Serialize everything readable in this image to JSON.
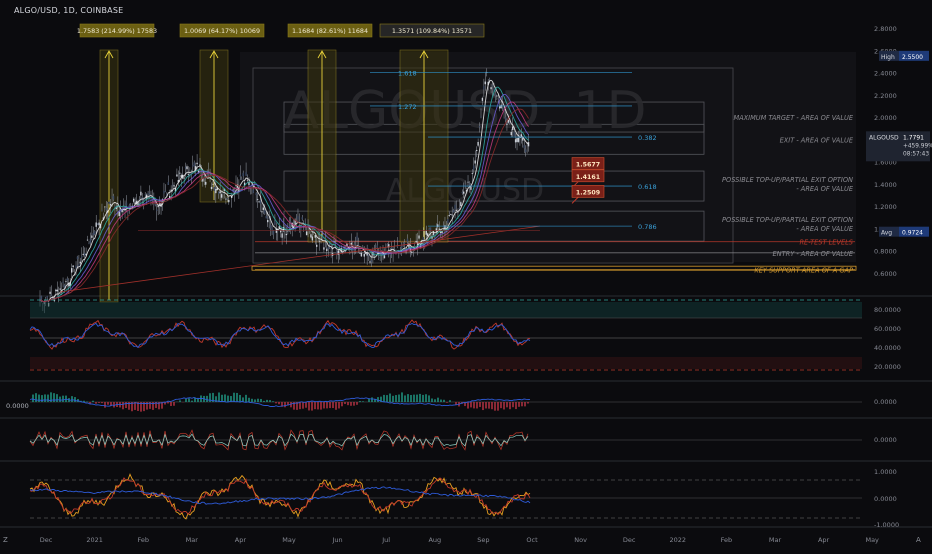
{
  "header": {
    "symbol_line": "ALGO/USD, 1D, COINBASE"
  },
  "watermark": {
    "symbol": "ALGOUSD, 1D",
    "pair": "ALGO/USD"
  },
  "chart_data": {
    "type": "candlestick",
    "title": "ALGO/USD, 1D, COINBASE",
    "ylim": [
      0.5,
      2.8
    ],
    "yticks": [
      "2.8000",
      "2.6000",
      "2.4000",
      "2.2000",
      "2.0000",
      "1.8000",
      "1.6000",
      "1.4000",
      "1.2000",
      "1.0000",
      "0.8000",
      "0.6000"
    ],
    "x_labels": [
      "Dec",
      "2021",
      "Feb",
      "Mar",
      "Apr",
      "May",
      "Jun",
      "Jul",
      "Aug",
      "Sep",
      "Oct",
      "Nov",
      "Dec",
      "2022",
      "Feb",
      "Mar",
      "Apr",
      "May"
    ],
    "price_series": [
      {
        "x": 0,
        "close": 0.35
      },
      {
        "x": 1,
        "close": 0.4
      },
      {
        "x": 2,
        "close": 0.55
      },
      {
        "x": 3,
        "close": 0.75
      },
      {
        "x": 4,
        "close": 1.05
      },
      {
        "x": 5,
        "close": 1.25
      },
      {
        "x": 6,
        "close": 1.15
      },
      {
        "x": 7,
        "close": 1.3
      },
      {
        "x": 8,
        "close": 1.2
      },
      {
        "x": 9,
        "close": 1.35
      },
      {
        "x": 10,
        "close": 1.5
      },
      {
        "x": 11,
        "close": 1.55
      },
      {
        "x": 12,
        "close": 1.4
      },
      {
        "x": 13,
        "close": 1.3
      },
      {
        "x": 14,
        "close": 1.45
      },
      {
        "x": 15,
        "close": 1.35
      },
      {
        "x": 16,
        "close": 1.0
      },
      {
        "x": 17,
        "close": 0.95
      },
      {
        "x": 18,
        "close": 1.05
      },
      {
        "x": 19,
        "close": 0.92
      },
      {
        "x": 20,
        "close": 0.85
      },
      {
        "x": 21,
        "close": 0.8
      },
      {
        "x": 22,
        "close": 0.85
      },
      {
        "x": 23,
        "close": 0.75
      },
      {
        "x": 24,
        "close": 0.82
      },
      {
        "x": 25,
        "close": 0.8
      },
      {
        "x": 26,
        "close": 0.85
      },
      {
        "x": 27,
        "close": 0.95
      },
      {
        "x": 28,
        "close": 1.0
      },
      {
        "x": 29,
        "close": 1.2
      },
      {
        "x": 30,
        "close": 1.45
      },
      {
        "x": 31,
        "close": 2.4
      },
      {
        "x": 32,
        "close": 2.1
      },
      {
        "x": 33,
        "close": 1.85
      },
      {
        "x": 34,
        "close": 1.7
      }
    ],
    "price_badges": [
      {
        "label": "High",
        "value": "2.5500",
        "color": "#1e3a78"
      },
      {
        "label": "ALGOUSD",
        "value": "1.7791",
        "sub1": "+459.99%",
        "sub2": "08:57:43",
        "color": "#1f2430"
      },
      {
        "label": "Avg",
        "value": "0.9724",
        "color": "#1e3a78"
      }
    ],
    "measure_labels": [
      "1.7583 (214.99%) 17583",
      "1.0069 (64.17%) 10069",
      "1.1684 (82.61%) 11684",
      "1.3571 (109.84%) 13571"
    ],
    "fib_levels": [
      {
        "label": "1.618",
        "value": 2.4
      },
      {
        "label": "1.272",
        "value": 2.1
      },
      {
        "label": "0.382",
        "value": 1.82
      },
      {
        "label": "0.618",
        "value": 1.38
      },
      {
        "label": "0.786",
        "value": 1.02
      }
    ],
    "target_labels": [
      {
        "value": "1.5677",
        "price": 1.6
      },
      {
        "value": "1.4161",
        "price": 1.49
      },
      {
        "value": "1.2509",
        "price": 1.35
      }
    ],
    "zones": [
      {
        "text": "MAXIMUM TARGET - AREA OF VALUE",
        "price": 2.0,
        "color": "#8a8a90"
      },
      {
        "text": "EXIT - AREA OF VALUE",
        "price": 1.8,
        "color": "#8a8a90"
      },
      {
        "text": "POSSIBLE TOP-UP/PARTIAL EXIT OPTION",
        "text2": "- AREA OF VALUE",
        "price": 1.38,
        "color": "#8a8a90"
      },
      {
        "text": "POSSIBLE TOP-UP/PARTIAL EXIT OPTION",
        "text2": "- AREA OF VALUE",
        "price": 1.02,
        "color": "#8a8a90"
      },
      {
        "text": "RE-TEST LEVELS",
        "price": 0.88,
        "color": "#c0392b"
      },
      {
        "text": "ENTRY - AREA OF VALUE",
        "price": 0.78,
        "color": "#8a8a90"
      },
      {
        "text": "KEY SUPPORT AREA OF A GAP",
        "price": 0.63,
        "color": "#d49a2e"
      }
    ],
    "rsi": {
      "ticks": [
        "80.0000",
        "60.0000",
        "40.0000",
        "20.0000"
      ],
      "ylim": [
        10,
        100
      ]
    },
    "macd": {
      "ticks": [
        "0.0000"
      ],
      "left_value": "0.0000"
    },
    "osc": {
      "ticks": [
        "0.0000"
      ]
    },
    "stoch": {
      "ticks": [
        "1.0000",
        "0.0000",
        "-1.0000"
      ]
    }
  },
  "toolbar": {
    "z_label": "Z",
    "a_label": "A"
  }
}
